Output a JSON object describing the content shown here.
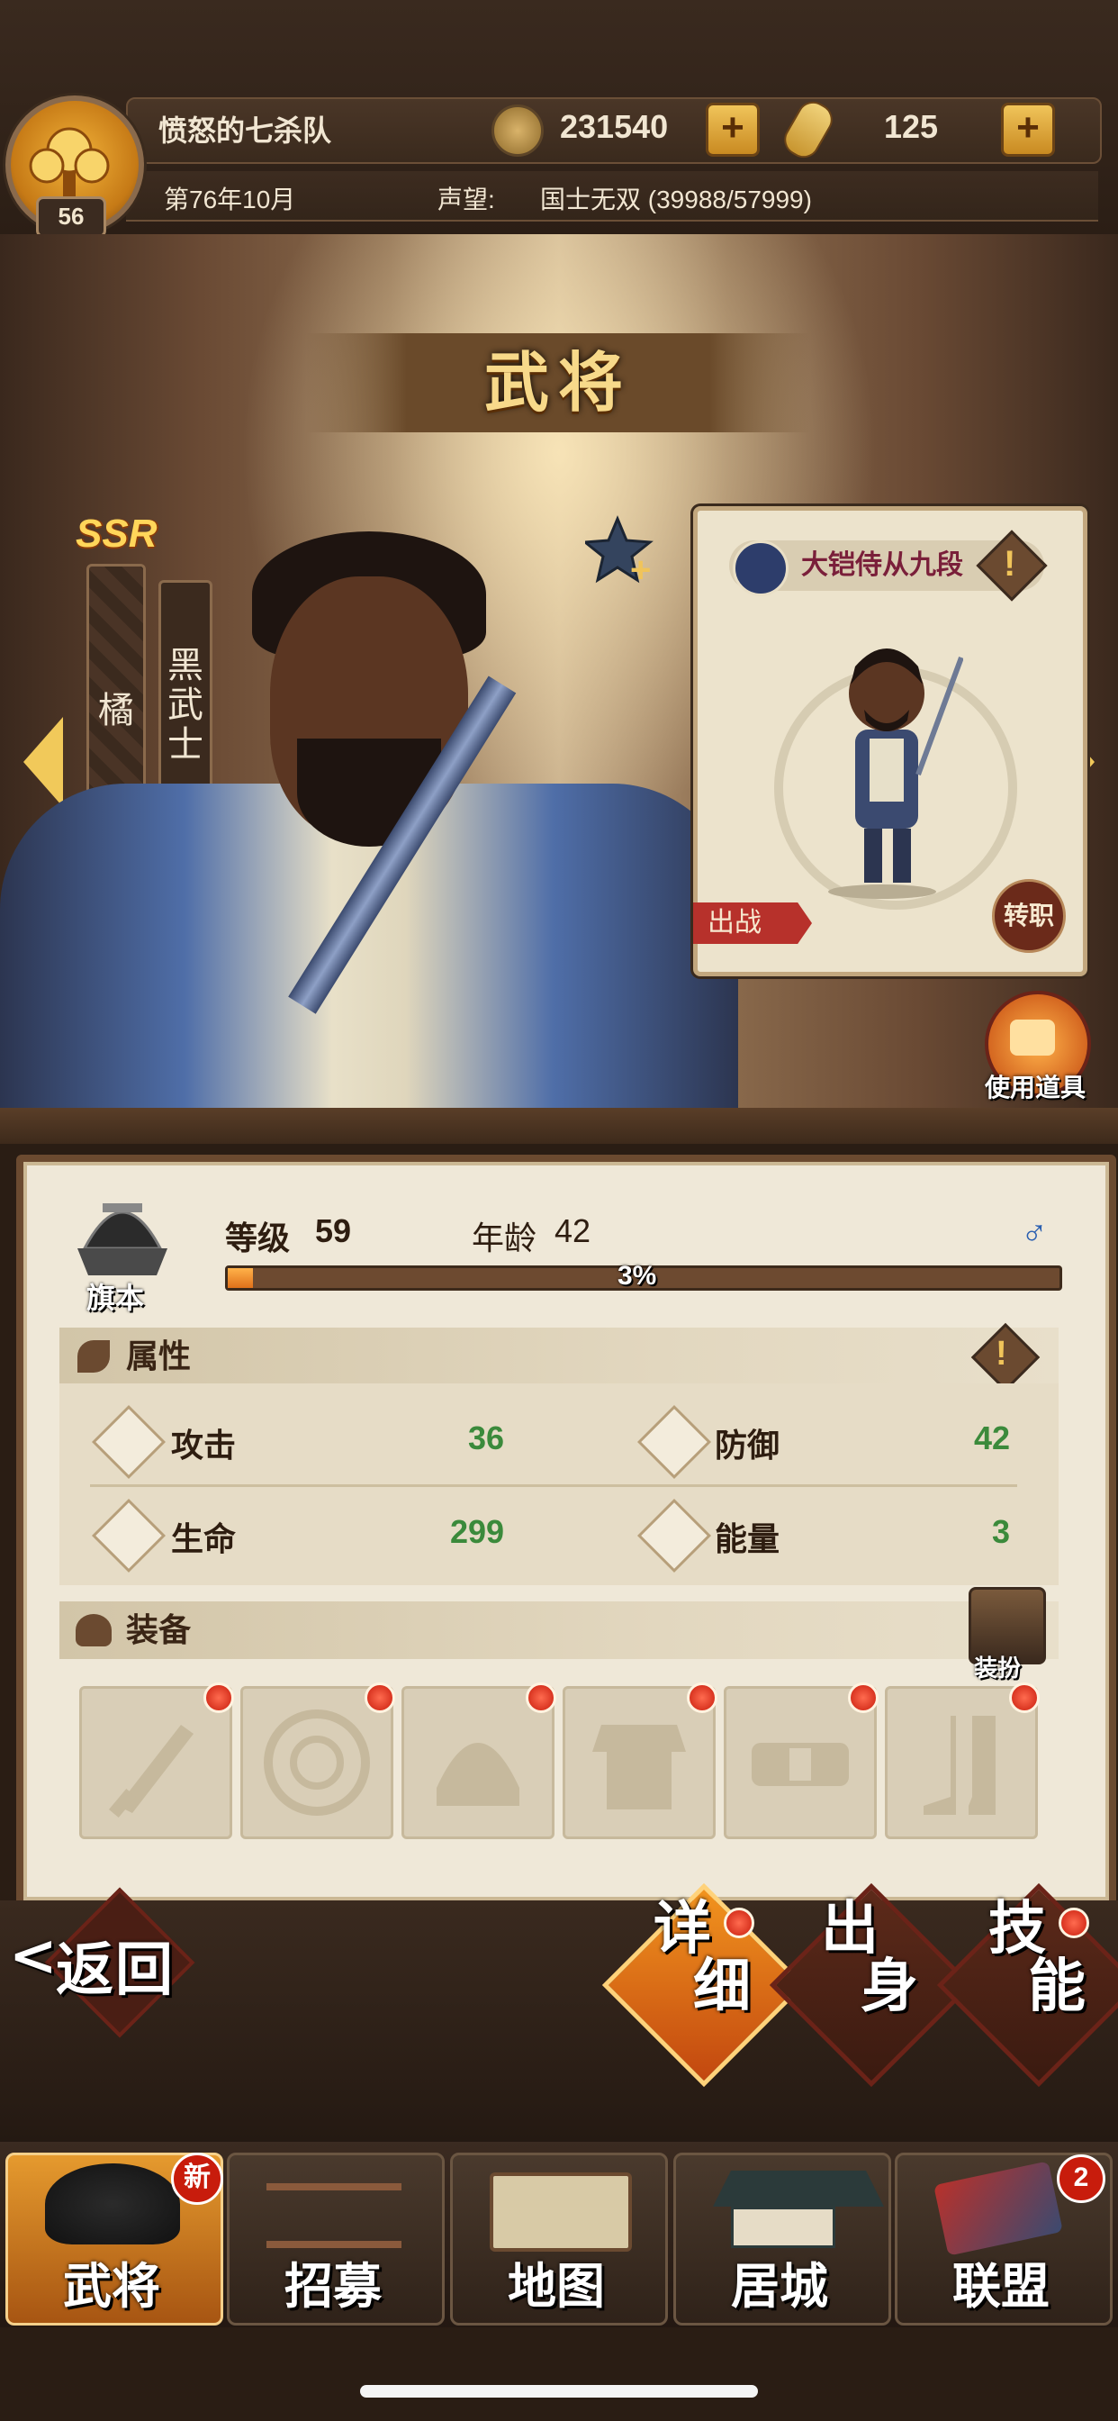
{
  "header": {
    "clan_name": "愤怒的七杀队",
    "player_level": "56",
    "date": "第76年10月",
    "reputation_label": "声望:",
    "reputation_value": "国士无双 (39988/57999)",
    "coins": "231540",
    "rice": "125"
  },
  "scene": {
    "title": "武将",
    "rarity": "SSR",
    "tag_left": "橘",
    "tag_right": "黑武士",
    "card_title": "大铠侍从九段",
    "deploy_label": "出战",
    "transfer_label": "转职",
    "use_item_label": "使用道具"
  },
  "detail": {
    "rank_label": "旗本",
    "level_label": "等级",
    "level_value": "59",
    "age_label": "年龄",
    "age_value": "42",
    "xp_percent": "3%",
    "xp_fraction": 0.03,
    "attributes_title": "属性",
    "stats": [
      {
        "label": "攻击",
        "value": "36"
      },
      {
        "label": "防御",
        "value": "42"
      },
      {
        "label": "生命",
        "value": "299"
      },
      {
        "label": "能量",
        "value": "3"
      }
    ],
    "equipment_title": "装备",
    "dress_label": "装扮",
    "equipment_slots": [
      "sword-icon",
      "shield-icon",
      "helmet-icon",
      "armor-icon",
      "belt-icon",
      "boots-icon"
    ]
  },
  "actions": {
    "back_label": "返回",
    "tabs": [
      "详细",
      "出身",
      "技能"
    ]
  },
  "nav": {
    "items": [
      "武将",
      "招募",
      "地图",
      "居城",
      "联盟"
    ],
    "new_badge": "新",
    "alliance_badge": "2"
  },
  "colors": {
    "accent_gold": "#f0c45a",
    "stat_green": "#3b8a3b",
    "alert_red": "#c81c0c"
  }
}
